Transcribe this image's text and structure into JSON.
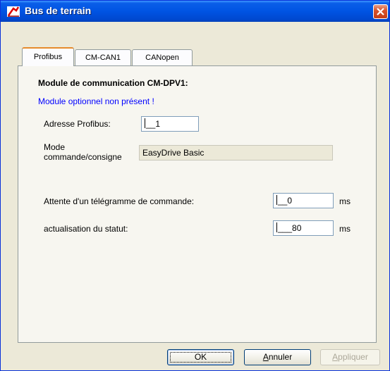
{
  "window": {
    "title": "Bus de terrain",
    "icon": "app-icon",
    "close_icon": "close-icon"
  },
  "tabs": [
    {
      "label": "Profibus",
      "active": true
    },
    {
      "label": "CM-CAN1",
      "active": false
    },
    {
      "label": "CANopen",
      "active": false
    }
  ],
  "panel": {
    "heading": "Module de communication CM-DPV1:",
    "status": "Module optionnel non présent !",
    "status_color": "#0000ff",
    "address_label": "Adresse Profibus:",
    "address_value": "1",
    "mode_label_line1": "Mode",
    "mode_label_line2": "commande/consigne",
    "mode_value": "EasyDrive Basic",
    "wait_label": "Attente d'un télégramme de commande:",
    "wait_value": "0",
    "wait_unit": "ms",
    "refresh_label": "actualisation du statut:",
    "refresh_value": "80",
    "refresh_unit": "ms"
  },
  "buttons": {
    "ok": "OK",
    "cancel_prefix": "A",
    "cancel_rest": "nnuler",
    "apply_prefix": "A",
    "apply_rest": "ppliquer"
  }
}
